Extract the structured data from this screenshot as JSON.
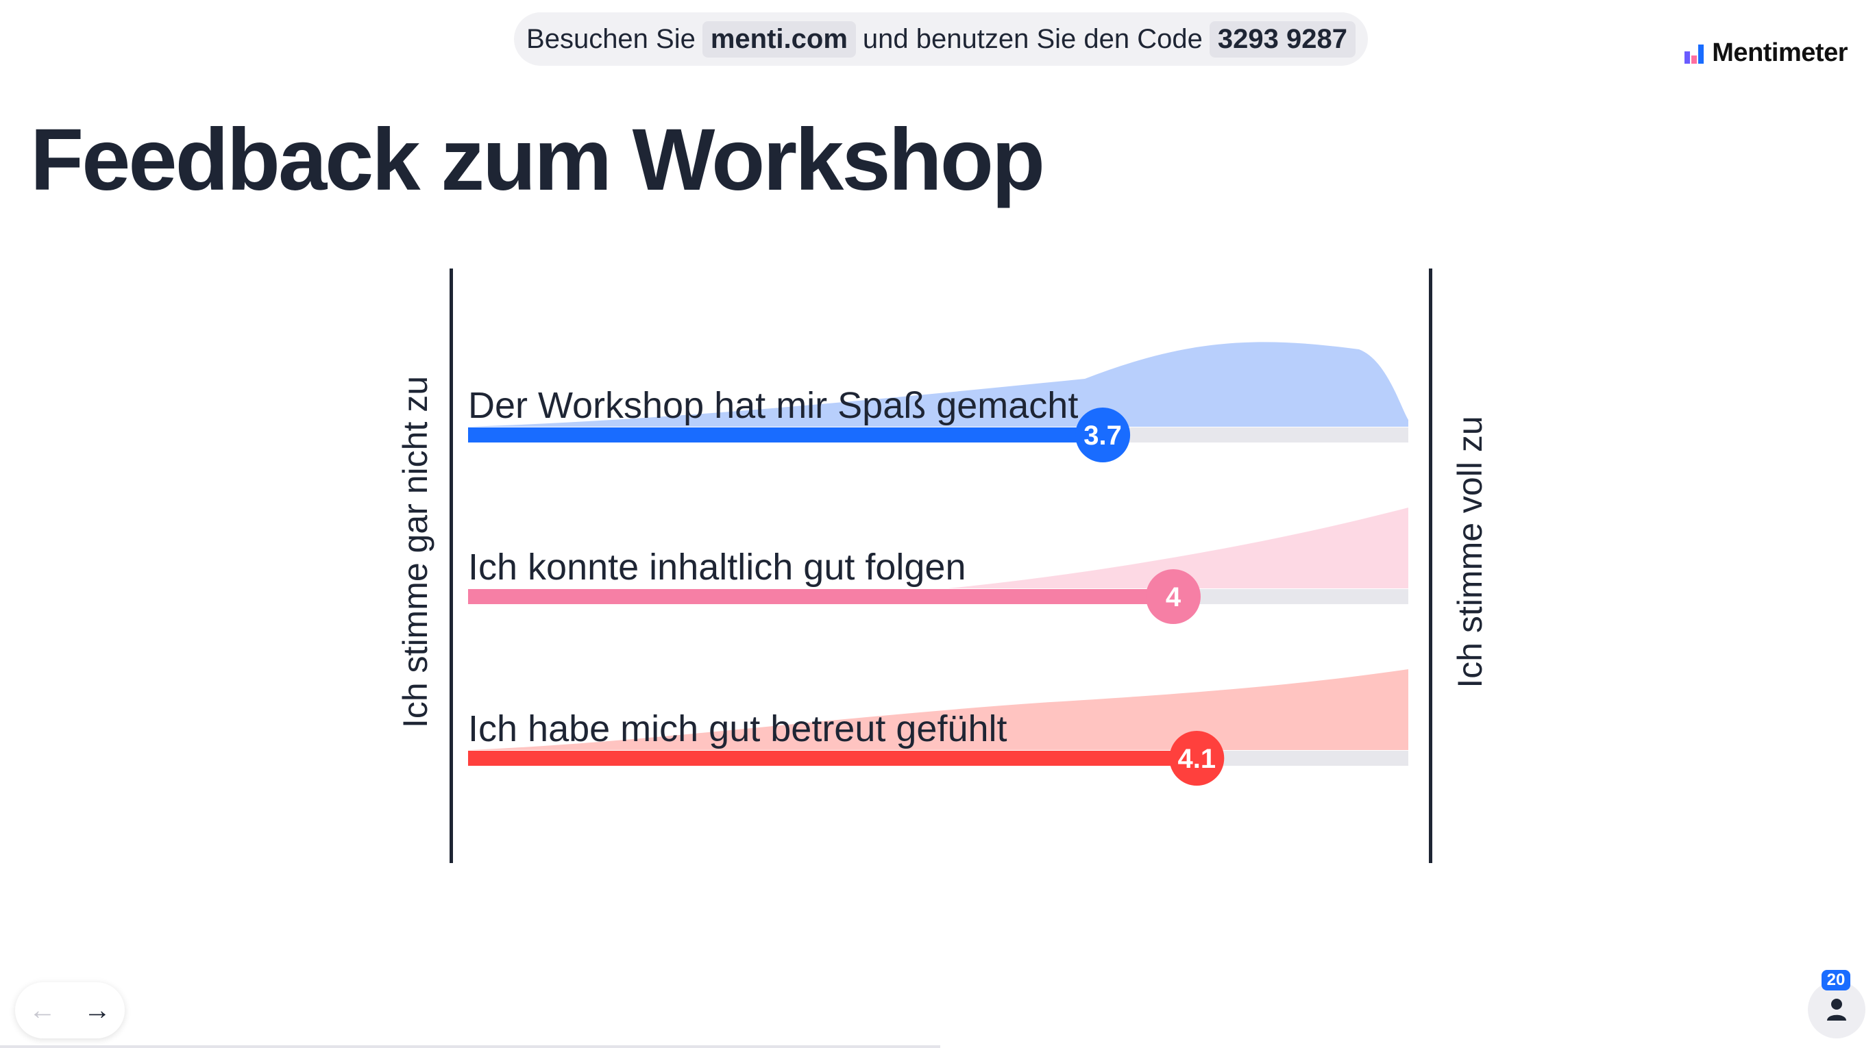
{
  "banner": {
    "prefix": "Besuchen Sie",
    "site": "menti.com",
    "middle": "und benutzen Sie den Code",
    "code": "3293 9287"
  },
  "brand": {
    "name": "Mentimeter"
  },
  "slide": {
    "title": "Feedback zum Workshop"
  },
  "scale": {
    "left_label": "Ich stimme gar nicht zu",
    "right_label": "Ich stimme voll zu"
  },
  "chart_data": {
    "type": "bar",
    "title": "Feedback zum Workshop",
    "xlim": [
      1,
      5
    ],
    "categories": [
      "Der Workshop hat mir Spaß gemacht",
      "Ich konnte inhaltlich gut folgen",
      "Ich habe mich gut betreut gefühlt"
    ],
    "values": [
      3.7,
      4,
      4.1
    ],
    "value_labels": [
      "3.7",
      "4",
      "4.1"
    ],
    "colors": [
      "#196cff",
      "#f67fa5",
      "#ff403d"
    ],
    "distribution_colors": [
      "#b8cffc",
      "#fdd9e4",
      "#ffc4c1"
    ]
  },
  "navigation": {
    "prev_icon": "arrow-left-icon",
    "next_icon": "arrow-right-icon"
  },
  "participants": {
    "count": "20",
    "icon": "person-icon"
  }
}
